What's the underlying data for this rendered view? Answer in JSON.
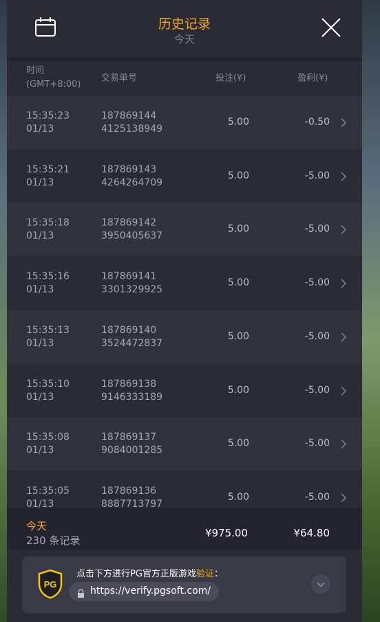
{
  "header": {
    "title": "历史记录",
    "subtitle": "今天"
  },
  "columns": {
    "time": "时间",
    "timezone": "(GMT+8:00)",
    "order_id": "交易单号",
    "bet": "投注(¥)",
    "profit": "盈利(¥)"
  },
  "rows": [
    {
      "time": "15:35:23",
      "date": "01/13",
      "id_line1": "187869144",
      "id_line2": "4125138949",
      "bet": "5.00",
      "profit": "-0.50"
    },
    {
      "time": "15:35:21",
      "date": "01/13",
      "id_line1": "187869143",
      "id_line2": "4264264709",
      "bet": "5.00",
      "profit": "-5.00"
    },
    {
      "time": "15:35:18",
      "date": "01/13",
      "id_line1": "187869142",
      "id_line2": "3950405637",
      "bet": "5.00",
      "profit": "-5.00"
    },
    {
      "time": "15:35:16",
      "date": "01/13",
      "id_line1": "187869141",
      "id_line2": "3301329925",
      "bet": "5.00",
      "profit": "-5.00"
    },
    {
      "time": "15:35:13",
      "date": "01/13",
      "id_line1": "187869140",
      "id_line2": "3524472837",
      "bet": "5.00",
      "profit": "-5.00"
    },
    {
      "time": "15:35:10",
      "date": "01/13",
      "id_line1": "187869138",
      "id_line2": "9146333189",
      "bet": "5.00",
      "profit": "-5.00"
    },
    {
      "time": "15:35:08",
      "date": "01/13",
      "id_line1": "187869137",
      "id_line2": "9084001285",
      "bet": "5.00",
      "profit": "-5.00"
    },
    {
      "time": "15:35:05",
      "date": "01/13",
      "id_line1": "187869136",
      "id_line2": "8887713797",
      "bet": "5.00",
      "profit": "-5.00"
    }
  ],
  "footer": {
    "period": "今天",
    "count": "230 条记录",
    "total_bet": "¥975.00",
    "total_profit": "¥64.80"
  },
  "verify": {
    "text": "点击下方进行PG官方正版游戏",
    "highlight": "验证",
    "colon": "：",
    "url": "https://verify.pgsoft.com/",
    "logo_text": "PG"
  },
  "icons": {
    "calendar": "calendar-icon",
    "close": "close-icon",
    "chevron": "chevron-right-icon",
    "lock": "lock-icon",
    "dropdown": "chevron-down-icon",
    "shield": "pg-shield-logo"
  },
  "colors": {
    "accent": "#f5a623",
    "panel": "#2b2b36",
    "row_odd": "#32323d",
    "row_even": "#2b2b36"
  }
}
